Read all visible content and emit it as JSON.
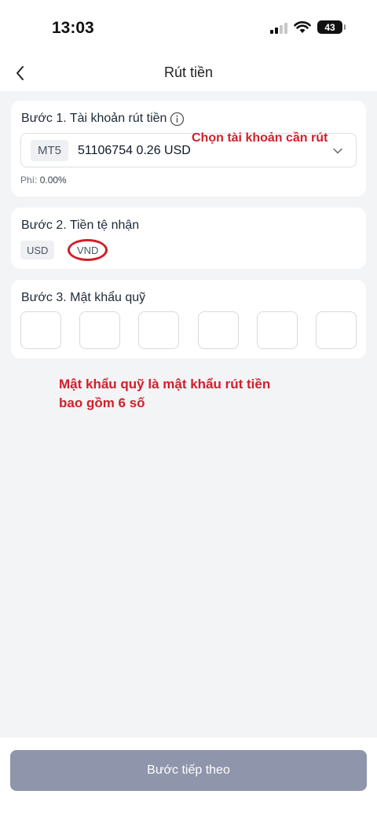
{
  "status_bar": {
    "time": "13:03",
    "battery": "43"
  },
  "header": {
    "title": "Rút tiền"
  },
  "step1": {
    "label": "Bước 1. Tài khoản rút tiền",
    "account_tag": "MT5",
    "account_value": "51106754 0.26 USD",
    "fee_label": "Phí: ",
    "fee_value": "0.00%",
    "annotation": "Chọn tài khoản cần rút"
  },
  "step2": {
    "label": "Bước 2. Tiền tệ nhận",
    "options": [
      "USD",
      "VND"
    ],
    "selected": "VND"
  },
  "step3": {
    "label": "Bước 3. Mật khẩu quỹ",
    "pin_length": 6
  },
  "annotation_note": {
    "line1": "Mật khẩu quỹ là mật khẩu rút tiền",
    "line2": "bao gồm 6 số"
  },
  "footer": {
    "next_label": "Bước tiếp theo"
  },
  "colors": {
    "annotation": "#d0202a",
    "button": "#8f95ab",
    "background": "#f3f4f6"
  },
  "icons": {
    "back": "chevron-left-icon",
    "info": "info-icon",
    "dropdown": "chevron-down-icon",
    "wifi": "wifi-icon",
    "signal": "signal-icon",
    "battery": "battery-icon"
  }
}
